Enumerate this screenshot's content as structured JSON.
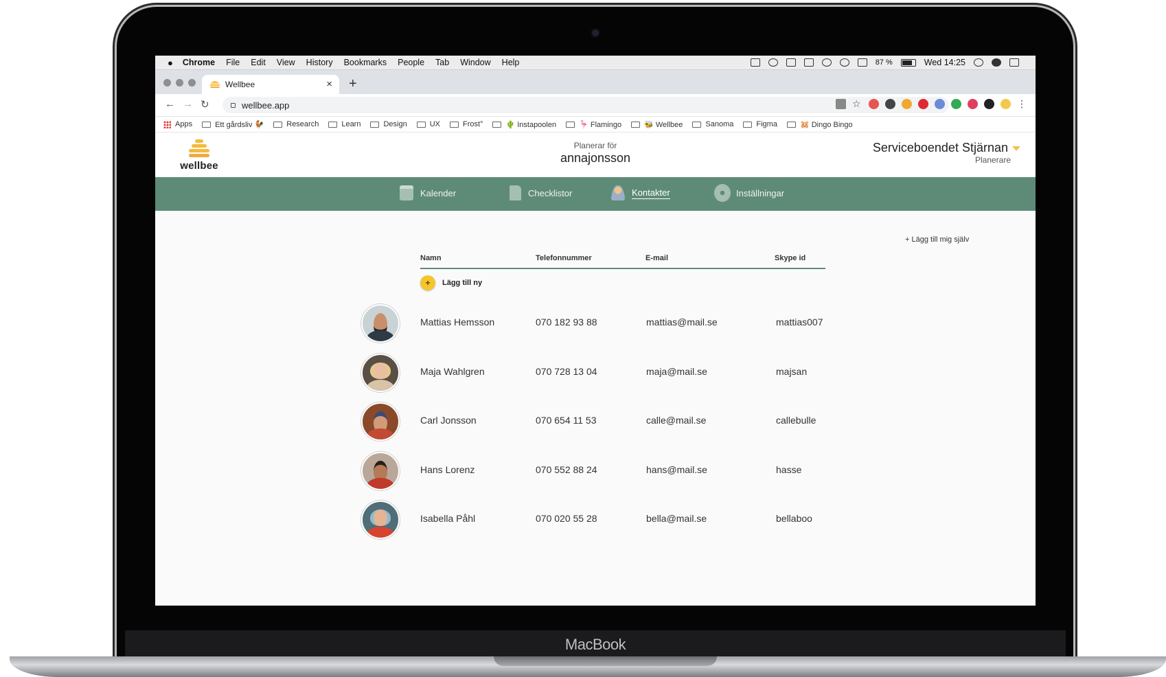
{
  "device": {
    "brand": "MacBook"
  },
  "menubar": {
    "app": "Chrome",
    "items": [
      "File",
      "Edit",
      "View",
      "History",
      "Bookmarks",
      "People",
      "Tab",
      "Window",
      "Help"
    ],
    "battery": "87 %",
    "clock": "Wed 14:25"
  },
  "browser": {
    "tab_title": "Wellbee",
    "tab_close": "×",
    "new_tab": "+",
    "url": "wellbee.app"
  },
  "bookmarks": [
    {
      "label": "Apps",
      "kind": "apps"
    },
    {
      "label": "Ett gårdsliv 🐓",
      "kind": "folder"
    },
    {
      "label": "Research",
      "kind": "folder"
    },
    {
      "label": "Learn",
      "kind": "folder"
    },
    {
      "label": "Design",
      "kind": "folder"
    },
    {
      "label": "UX",
      "kind": "folder"
    },
    {
      "label": "Frost°",
      "kind": "folder"
    },
    {
      "label": "🌵 Instapoolen",
      "kind": "folder"
    },
    {
      "label": "🦩 Flamingo",
      "kind": "folder"
    },
    {
      "label": "🐝 Wellbee",
      "kind": "folder"
    },
    {
      "label": "Sanoma",
      "kind": "folder"
    },
    {
      "label": "Figma",
      "kind": "folder"
    },
    {
      "label": "🐹 Dingo Bingo",
      "kind": "folder"
    }
  ],
  "header": {
    "logo_text": "wellbee",
    "planning_for_label": "Planerar för",
    "planning_user": "annajonsson",
    "org_name": "Serviceboendet Stjärnan",
    "org_role": "Planerare",
    "logo_color": "#f6b93b"
  },
  "nav": {
    "background": "#5e8b77",
    "items": [
      {
        "label": "Kalender",
        "icon": "calendar-icon"
      },
      {
        "label": "Checklistor",
        "icon": "checklist-icon"
      },
      {
        "label": "Kontakter",
        "icon": "contact-icon",
        "active": true
      },
      {
        "label": "Inställningar",
        "icon": "gear-icon"
      }
    ]
  },
  "contacts": {
    "add_self": "+ Lägg till mig själv",
    "add_new": "Lägg till ny",
    "add_new_symbol": "+",
    "columns": [
      "Namn",
      "Telefonnummer",
      "E-mail",
      "Skype id"
    ],
    "rows": [
      {
        "name": "Mattias Hemsson",
        "phone": "070 182 93 88",
        "email": "mattias@mail.se",
        "skype": "mattias007"
      },
      {
        "name": "Maja Wahlgren",
        "phone": "070 728 13 04",
        "email": "maja@mail.se",
        "skype": "majsan"
      },
      {
        "name": "Carl Jonsson",
        "phone": "070 654 11 53",
        "email": "calle@mail.se",
        "skype": "callebulle"
      },
      {
        "name": "Hans Lorenz",
        "phone": "070 552 88 24",
        "email": "hans@mail.se",
        "skype": "hasse"
      },
      {
        "name": "Isabella Påhl",
        "phone": "070 020 55 28",
        "email": "bella@mail.se",
        "skype": "bellaboo"
      }
    ]
  }
}
